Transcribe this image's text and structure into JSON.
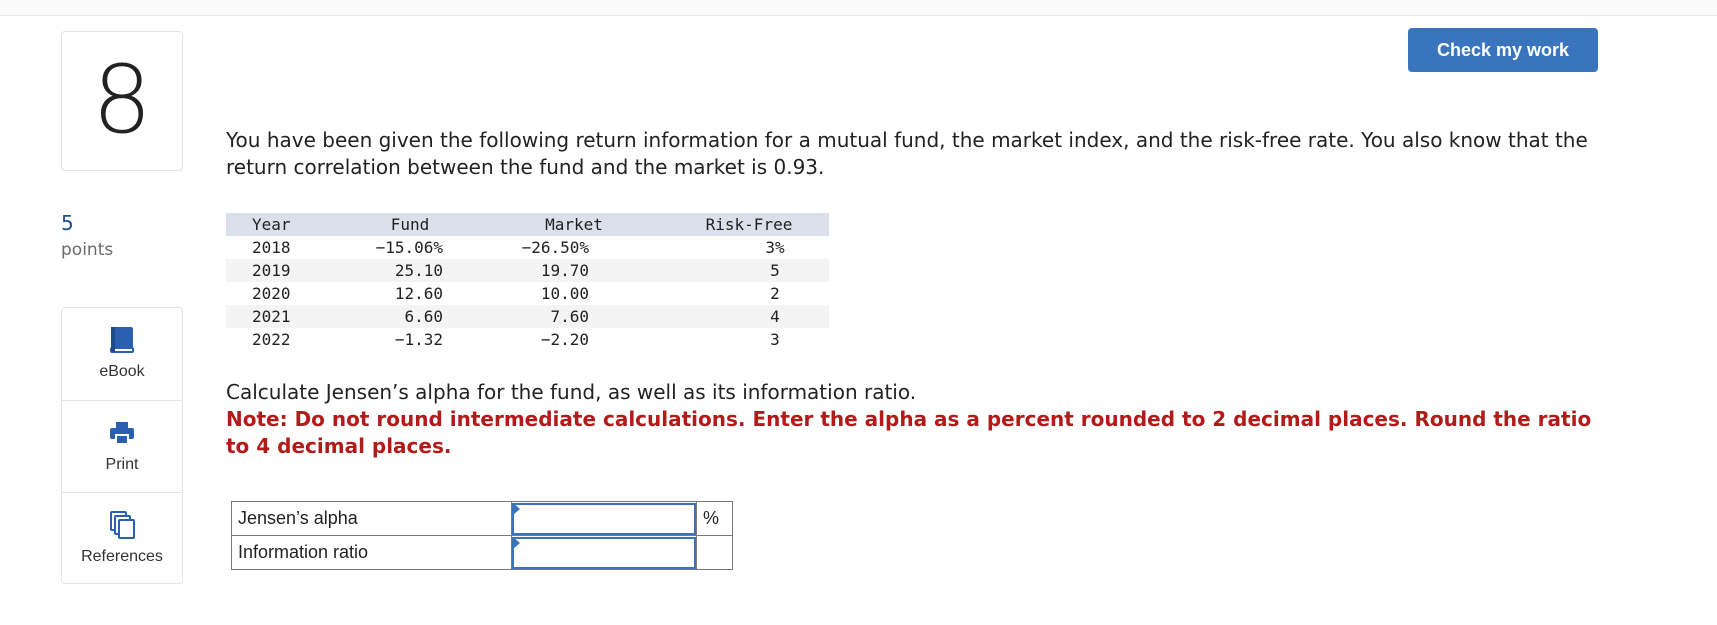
{
  "question": {
    "number": "8",
    "points_value": "5",
    "points_label": "points",
    "prompt": "You have been given the following return information for a mutual fund, the market index, and the risk-free rate. You also know that the return correlation between the fund and the market is 0.93.",
    "instruction": "Calculate Jensen’s alpha for the fund, as well as its information ratio.",
    "note": "Note: Do not round intermediate calculations. Enter the alpha as a percent rounded to 2 decimal places. Round the ratio to 4 decimal places."
  },
  "toolbar": {
    "check_label": "Check my work"
  },
  "tools": {
    "ebook_label": "eBook",
    "ebook_icon": "book-icon",
    "print_label": "Print",
    "print_icon": "printer-icon",
    "references_label": "References",
    "references_icon": "documents-icon"
  },
  "returns_table": {
    "headers": [
      "Year",
      "Fund",
      "Market",
      "Risk-Free"
    ],
    "rows": [
      [
        "2018",
        "−15.06%",
        "−26.50%",
        "3%"
      ],
      [
        "2019",
        "25.10",
        "19.70",
        "5"
      ],
      [
        "2020",
        "12.60",
        "10.00",
        "2"
      ],
      [
        "2021",
        "6.60",
        "7.60",
        "4"
      ],
      [
        "2022",
        "−1.32",
        "−2.20",
        "3"
      ]
    ]
  },
  "answers": {
    "alpha_label": "Jensen’s alpha",
    "alpha_value": "",
    "alpha_unit": "%",
    "ratio_label": "Information ratio",
    "ratio_value": "",
    "ratio_unit": ""
  },
  "colors": {
    "accent": "#3a74bd",
    "note_red": "#b31b1b",
    "points_blue": "#1d4f8f"
  }
}
